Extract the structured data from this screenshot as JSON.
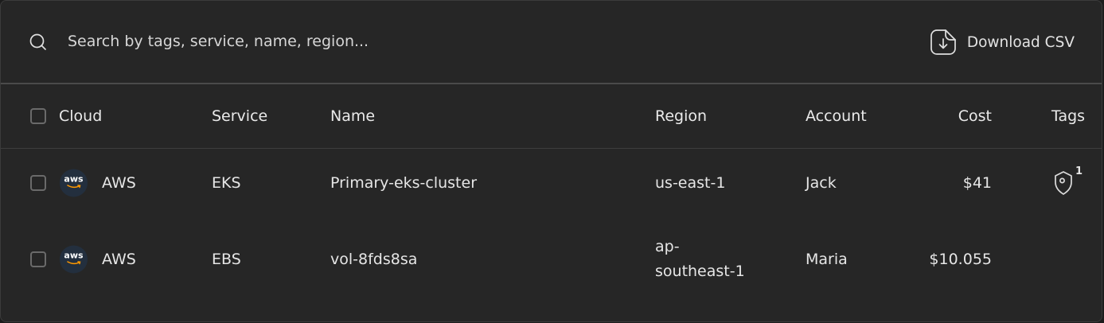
{
  "toolbar": {
    "search_placeholder": "Search by tags, service, name, region...",
    "download_label": "Download CSV",
    "search_icon": "search-icon",
    "download_icon": "file-download-icon"
  },
  "table": {
    "columns": [
      "Cloud",
      "Service",
      "Name",
      "Region",
      "Account",
      "Cost",
      "Tags"
    ],
    "rows": [
      {
        "cloud_logo_text": "aws",
        "cloud": "AWS",
        "service": "EKS",
        "name": "Primary-eks-cluster",
        "region": "us-east-1",
        "account": "Jack",
        "cost": "$41",
        "tags_count": "1",
        "tags_icon": "tag-icon"
      },
      {
        "cloud_logo_text": "aws",
        "cloud": "AWS",
        "service": "EBS",
        "name": "vol-8fds8sa",
        "region": "ap-southeast-1",
        "account": "Maria",
        "cost": "$10.055"
      }
    ]
  },
  "colors": {
    "background": "#262626",
    "text": "#e6e6e6",
    "aws_logo_bg": "#232f3e",
    "aws_smile": "#ff9900"
  }
}
